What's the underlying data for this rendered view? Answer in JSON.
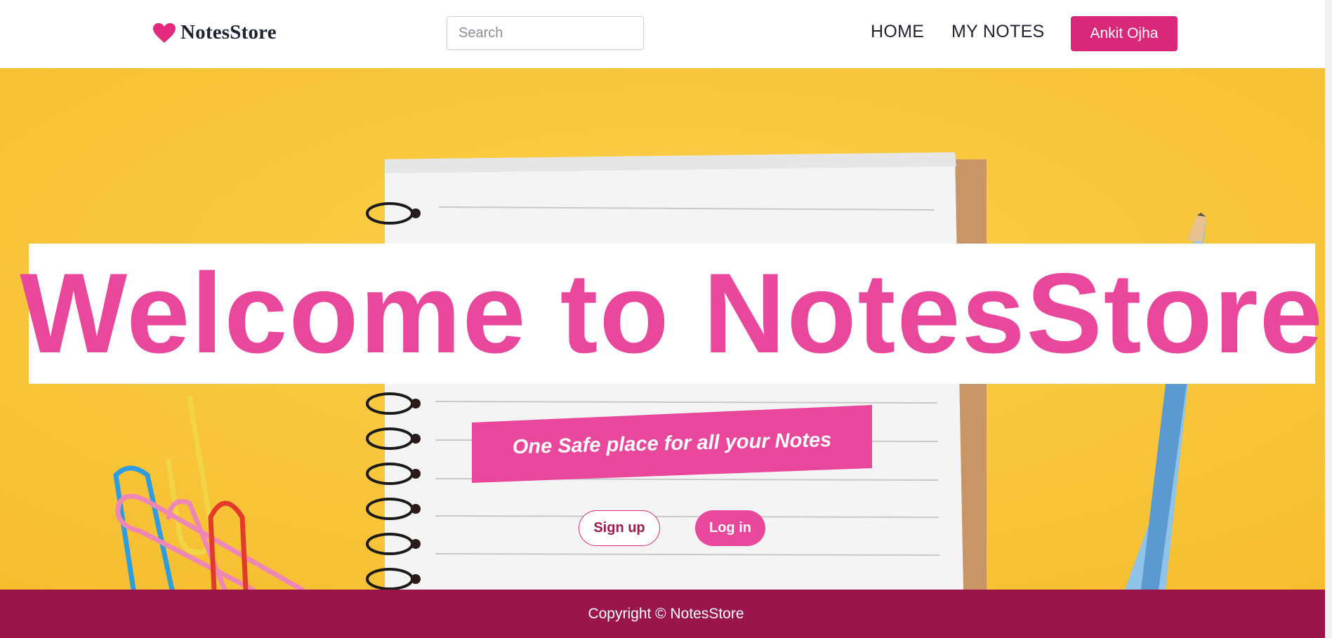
{
  "header": {
    "brand_name": "NotesStore",
    "brand_icon": "heart-icon",
    "search_placeholder": "Search",
    "nav": [
      {
        "label": "HOME"
      },
      {
        "label": "MY NOTES"
      }
    ],
    "user_name": "Ankit Ojha"
  },
  "hero": {
    "title": "Welcome to NotesStore",
    "tagline": "One Safe place for all your Notes",
    "signup_label": "Sign up",
    "login_label": "Log in"
  },
  "footer": {
    "copyright": "Copyright © NotesStore"
  },
  "colors": {
    "accent": "#d9287a",
    "title_pink": "#e9479b",
    "footer": "#99154a",
    "hero_bg": "#f9c739"
  }
}
